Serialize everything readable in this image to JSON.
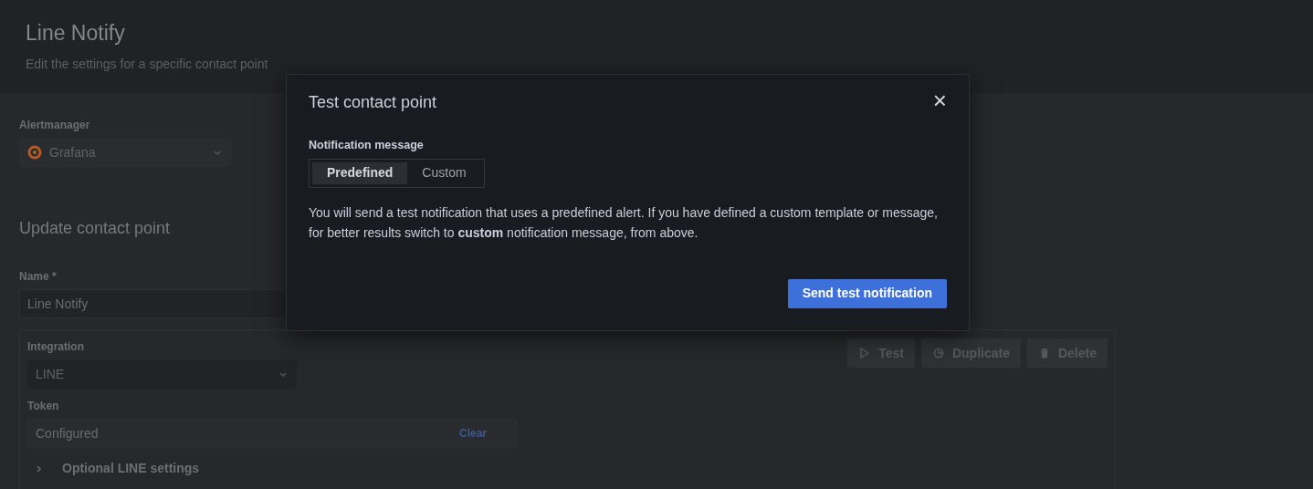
{
  "page_header": {
    "title": "Line Notify",
    "subtitle": "Edit the settings for a specific contact point"
  },
  "alertmanager": {
    "label": "Alertmanager",
    "value": "Grafana"
  },
  "section_title": "Update contact point",
  "name_field": {
    "label": "Name *",
    "value": "Line Notify"
  },
  "integration": {
    "label": "Integration",
    "value": "LINE",
    "actions": [
      {
        "label": "Test",
        "kind": "test"
      },
      {
        "label": "Duplicate",
        "kind": "duplicate"
      },
      {
        "label": "Delete",
        "kind": "delete"
      }
    ],
    "token": {
      "label": "Token",
      "value": "Configured",
      "action": "Clear"
    },
    "optional_settings": {
      "label": "Optional LINE settings",
      "expanded": false
    }
  },
  "dialog": {
    "title": "Test contact point",
    "close": "×",
    "field_label": "Notification message",
    "options": [
      {
        "label": "Predefined",
        "selected": true
      },
      {
        "label": "Custom",
        "selected": false
      }
    ],
    "message": "You will send a test notification that uses a predefined alert. If you have defined a custom template or message, for better results switch to **custom** notification message, from above.",
    "submit": "Send test notification"
  }
}
